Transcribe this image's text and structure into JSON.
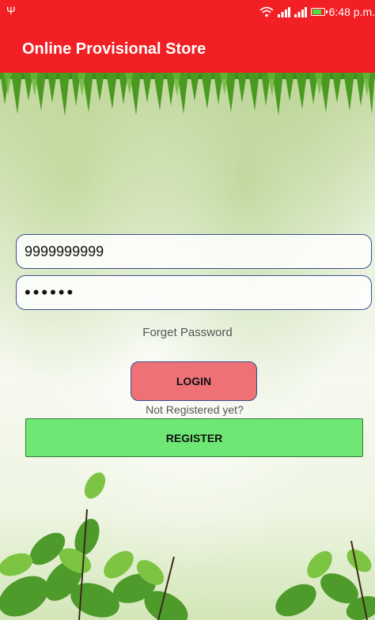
{
  "status_bar": {
    "usb_icon": "usb-icon",
    "time": "6:48 p.m."
  },
  "app_bar": {
    "title": "Online Provisional Store",
    "color": "#f21f24"
  },
  "form": {
    "phone_value": "9999999999",
    "password_value": "••••••",
    "forgot_label": "Forget Password",
    "login_label": "LOGIN",
    "login_color": "#ee7176",
    "not_registered_label": "Not Registered yet?",
    "register_label": "REGISTER",
    "register_color": "#6ee774"
  }
}
